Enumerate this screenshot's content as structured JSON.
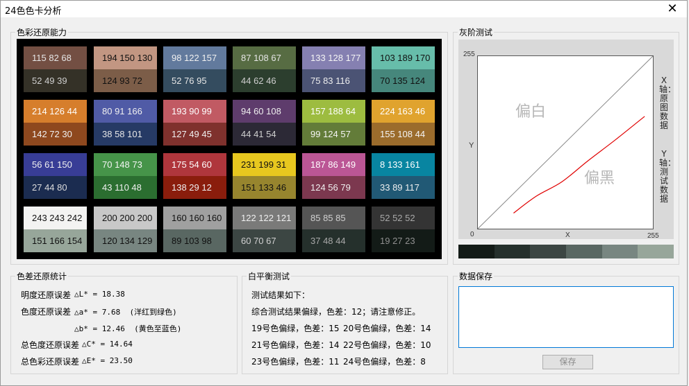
{
  "window": {
    "title": "24色色卡分析",
    "close_glyph": "✕"
  },
  "groups": {
    "color_reproduction": "色彩还原能力",
    "gray_test": "灰阶测试",
    "error_stats": "色差还原统计",
    "white_balance": "白平衡测试",
    "data_save": "数据保存"
  },
  "patches": [
    {
      "top": "115 82 68",
      "bottom": "52 49 39",
      "top_color": "#734f43",
      "bottom_color": "#343127",
      "top_text": "#e6e6e6",
      "bottom_text": "#cfcfcf"
    },
    {
      "top": "194 150 130",
      "bottom": "124 93 72",
      "top_color": "#c29682",
      "bottom_color": "#7c5d48",
      "top_text": "#111",
      "bottom_text": "#111"
    },
    {
      "top": "98 122 157",
      "bottom": "52 76 95",
      "top_color": "#627a9d",
      "bottom_color": "#344c5f",
      "top_text": "#f0f0f0",
      "bottom_text": "#e6e6e6"
    },
    {
      "top": "87 108 67",
      "bottom": "44 62 46",
      "top_color": "#576c43",
      "bottom_color": "#2c3e2e",
      "top_text": "#e6e6e6",
      "bottom_text": "#cfcfcf"
    },
    {
      "top": "133 128 177",
      "bottom": "75 83 116",
      "top_color": "#8580b1",
      "bottom_color": "#4b5374",
      "top_text": "#f5f5f5",
      "bottom_text": "#eee"
    },
    {
      "top": "103 189 170",
      "bottom": "70 135 124",
      "top_color": "#67bdaa",
      "bottom_color": "#46877c",
      "top_text": "#111",
      "bottom_text": "#111"
    },
    {
      "top": "214 126 44",
      "bottom": "142 72 30",
      "top_color": "#d67e2c",
      "bottom_color": "#8e481e",
      "top_text": "#fff",
      "bottom_text": "#f0f0f0"
    },
    {
      "top": "80 91 166",
      "bottom": "38 58 101",
      "top_color": "#505ba6",
      "bottom_color": "#263a65",
      "top_text": "#f0f0f0",
      "bottom_text": "#e6e6e6"
    },
    {
      "top": "193 90 99",
      "bottom": "127 49 45",
      "top_color": "#c15a63",
      "bottom_color": "#7f312d",
      "top_text": "#fff",
      "bottom_text": "#f0f0f0"
    },
    {
      "top": "94 60 108",
      "bottom": "44 41 54",
      "top_color": "#5e3c6c",
      "bottom_color": "#2c2936",
      "top_text": "#eee",
      "bottom_text": "#d0d0d0"
    },
    {
      "top": "157 188 64",
      "bottom": "99 124 57",
      "top_color": "#9dbc40",
      "bottom_color": "#637c39",
      "top_text": "#fff",
      "bottom_text": "#f5f5f5"
    },
    {
      "top": "224 163 46",
      "bottom": "155 108 44",
      "top_color": "#e0a32e",
      "bottom_color": "#9b6c2c",
      "top_text": "#fff",
      "bottom_text": "#f5f5f5"
    },
    {
      "top": "56 61 150",
      "bottom": "27 44 80",
      "top_color": "#383d96",
      "bottom_color": "#1b2c50",
      "top_text": "#f0f0f0",
      "bottom_text": "#dcdcdc"
    },
    {
      "top": "70 148 73",
      "bottom": "43 110 48",
      "top_color": "#469449",
      "bottom_color": "#2b6e30",
      "top_text": "#f5f5f5",
      "bottom_text": "#f0f0f0"
    },
    {
      "top": "175 54 60",
      "bottom": "138 29 12",
      "top_color": "#af363c",
      "bottom_color": "#8a1d0c",
      "top_text": "#fff",
      "bottom_text": "#f0f0f0"
    },
    {
      "top": "231 199 31",
      "bottom": "151 133 46",
      "top_color": "#e7c71f",
      "bottom_color": "#97852e",
      "top_text": "#111",
      "bottom_text": "#111"
    },
    {
      "top": "187 86 149",
      "bottom": "124 56 79",
      "top_color": "#bb5695",
      "bottom_color": "#7c384f",
      "top_text": "#fff",
      "bottom_text": "#f0f0f0"
    },
    {
      "top": "8 133 161",
      "bottom": "33 89 117",
      "top_color": "#0885a1",
      "bottom_color": "#215975",
      "top_text": "#fff",
      "bottom_text": "#f0f0f0"
    },
    {
      "top": "243 243 242",
      "bottom": "151 166 154",
      "top_color": "#f3f3f2",
      "bottom_color": "#97a69a",
      "top_text": "#111",
      "bottom_text": "#111"
    },
    {
      "top": "200 200 200",
      "bottom": "120 134 129",
      "top_color": "#c8c8c8",
      "bottom_color": "#788681",
      "top_text": "#111",
      "bottom_text": "#111"
    },
    {
      "top": "160 160 160",
      "bottom": "89 103 98",
      "top_color": "#a0a0a0",
      "bottom_color": "#596762",
      "top_text": "#111",
      "bottom_text": "#111"
    },
    {
      "top": "122 122 121",
      "bottom": "60 70 67",
      "top_color": "#7a7a79",
      "bottom_color": "#3c4643",
      "top_text": "#f0f0f0",
      "bottom_text": "#d0d0d0"
    },
    {
      "top": "85 85 85",
      "bottom": "37 48 44",
      "top_color": "#555555",
      "bottom_color": "#25302c",
      "top_text": "#d0d0d0",
      "bottom_text": "#a8a8a8"
    },
    {
      "top": "52 52 52",
      "bottom": "19 27 23",
      "top_color": "#343434",
      "bottom_color": "#131b17",
      "top_text": "#a8a8a8",
      "bottom_text": "#909090"
    }
  ],
  "gray_test": {
    "y_max": "255",
    "y_label": "Y",
    "origin": "0",
    "x_label": "X",
    "x_max": "255",
    "label_white": "偏白",
    "label_black": "偏黑",
    "x_axis_desc": "X轴：原图数据",
    "y_axis_desc": "Y轴：测试数据",
    "strip_colors": [
      "#131b17",
      "#25302c",
      "#3c4643",
      "#596762",
      "#788681",
      "#97a69a"
    ],
    "curve_color": "#e00000"
  },
  "chart_data": {
    "type": "line",
    "xlabel": "X",
    "ylabel": "Y",
    "xlim": [
      0,
      255
    ],
    "ylim": [
      0,
      255
    ],
    "series": [
      {
        "x": [
          0,
          255
        ],
        "y": [
          0,
          255
        ]
      },
      {
        "x": [
          52,
          85,
          122,
          160,
          200,
          243
        ],
        "y": [
          23,
          48,
          69,
          100,
          131,
          166
        ]
      }
    ]
  },
  "stats": {
    "l_label": "明度还原误差",
    "l_value": "△L* = 18.38",
    "a_label": "色度还原误差",
    "a_value": "△a* = 7.68  (洋红到绿色)",
    "b_value": "△b* = 12.46  (黄色至蓝色)",
    "c_label": "总色度还原误差",
    "c_value": "△C* = 14.64",
    "e_label": "总色彩还原误差",
    "e_value": "△E* = 23.50"
  },
  "white_balance": {
    "intro": "测试结果如下：",
    "summary": "综合测试结果偏绿，色差：12；请注意修正。",
    "r19": "19号色偏绿，色差：15",
    "r20": "20号色偏绿，色差：14",
    "r21": "21号色偏绿，色差：14",
    "r22": "22号色偏绿，色差：10",
    "r23": "23号色偏绿，色差：11",
    "r24": "24号色偏绿，色差：8"
  },
  "save": {
    "button_label": "保存",
    "content": ""
  }
}
